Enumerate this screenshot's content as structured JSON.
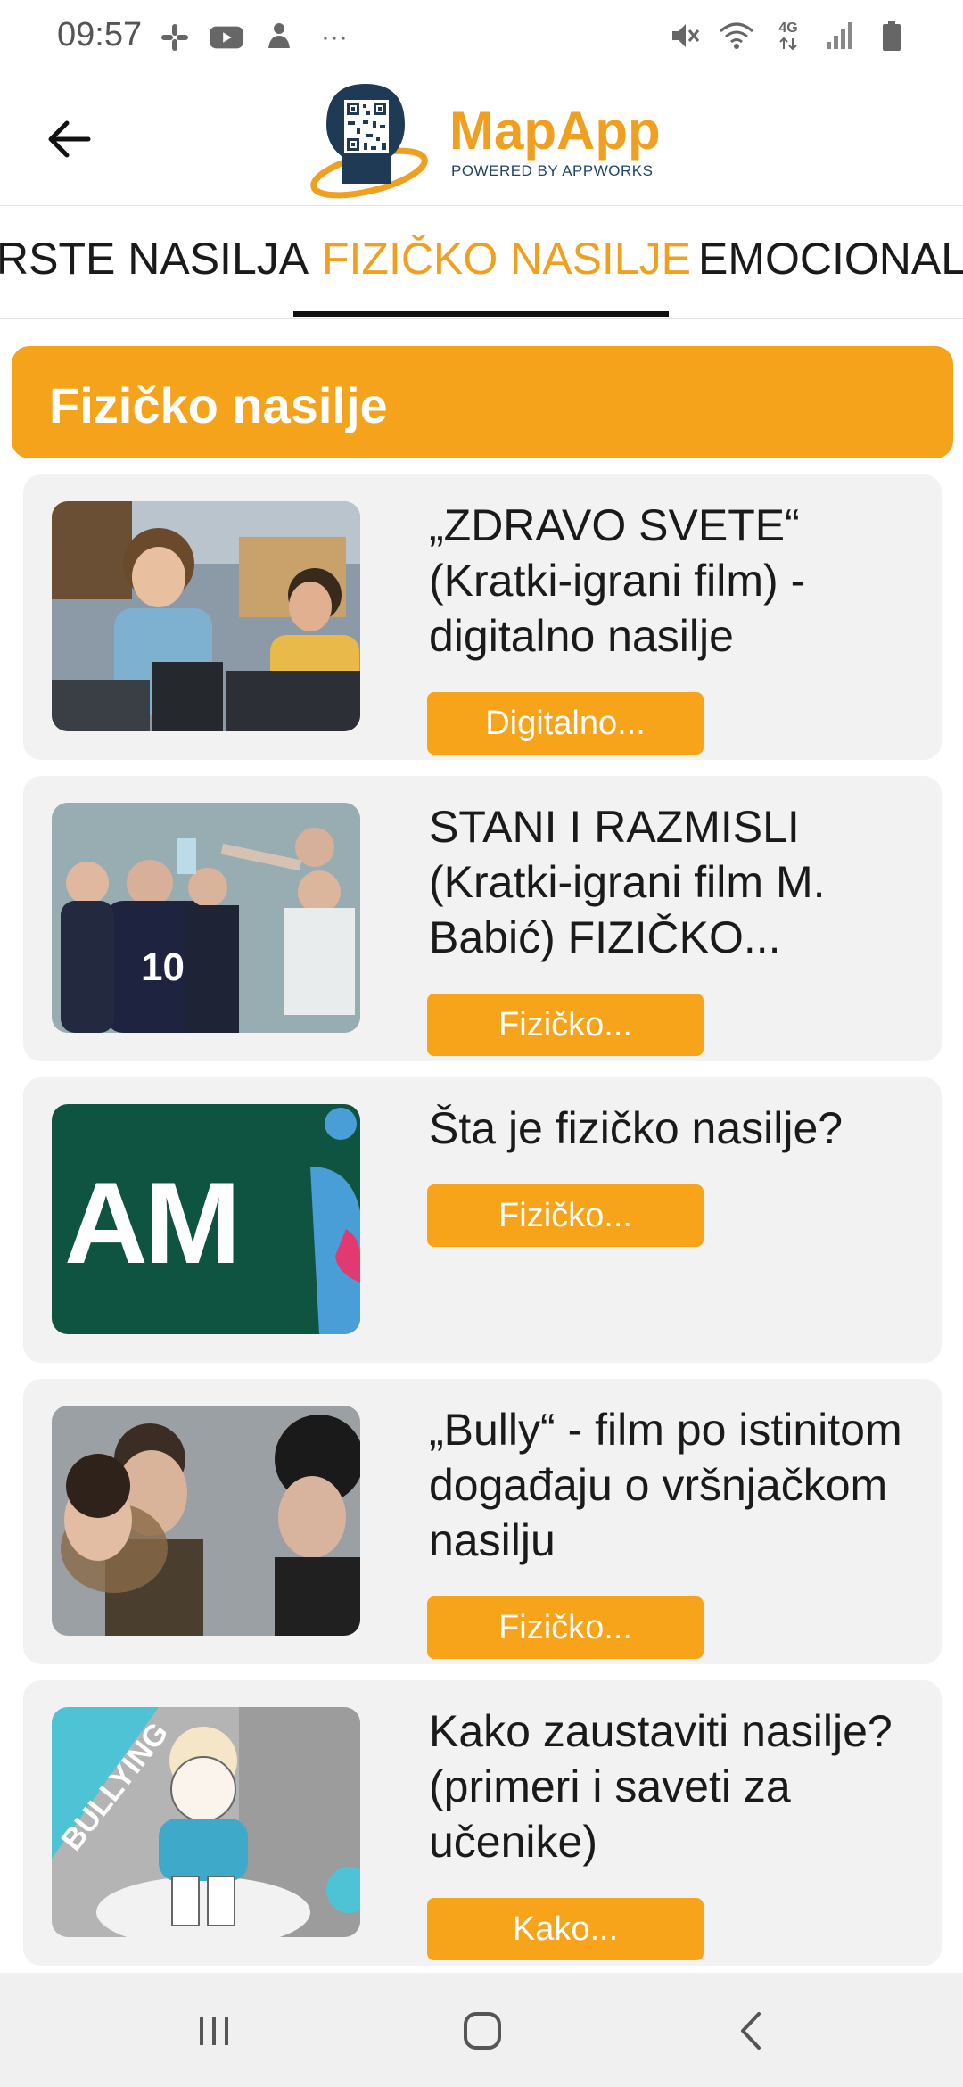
{
  "status_bar": {
    "time": "09:57",
    "left_icons": [
      "slack-icon",
      "youtube-icon",
      "notification-icon",
      "more-icon"
    ],
    "right_icons": [
      "mute-icon",
      "wifi-icon",
      "4g-icon",
      "signal-icon",
      "battery-icon"
    ],
    "network": "4G",
    "more": "···"
  },
  "header": {
    "logo_name": "MapApp",
    "logo_sub": "POWERED BY APPWORKS",
    "brand_color": "#f0a01e"
  },
  "tabs": [
    {
      "label": "VRSTE NASILJA",
      "visible_label": "RSTE NASILJA"
    },
    {
      "label": "FIZIČKO NASILJE",
      "active": true
    },
    {
      "label": "EMOCIONALNO",
      "visible_label": "EMOCIONALN"
    }
  ],
  "section": {
    "title": "Fizičko nasilje"
  },
  "cards": [
    {
      "title": "„ZDRAVO SVETE“ (Kratki-igrani film) - digitalno nasilje",
      "button": "Digitalno...",
      "thumb_icon": "video-thumbnail-icon"
    },
    {
      "title": "STANI I RAZMISLI (Kratki-igrani film M. Babić) FIZIČKO...",
      "button": "Fizičko...",
      "thumb_icon": "video-thumbnail-icon",
      "jersey_number": "10"
    },
    {
      "title": "Šta je fizičko nasilje?",
      "button": "Fizičko...",
      "thumb_icon": "video-thumbnail-icon",
      "thumb_text": "AM"
    },
    {
      "title": "„Bully“ - film po istinitom događaju o vršnjačkom nasilju",
      "button": "Fizičko...",
      "thumb_icon": "video-thumbnail-icon"
    },
    {
      "title": "Kako zaustaviti nasilje? (primeri i saveti za učenike)",
      "button": "Kako...",
      "thumb_icon": "video-thumbnail-icon",
      "thumb_text": "BULLYING"
    }
  ],
  "navbar": {
    "icons": [
      "recent-apps-icon",
      "home-icon",
      "back-nav-icon"
    ]
  },
  "colors": {
    "accent": "#f5a31b",
    "card_bg": "#f2f2f2"
  }
}
